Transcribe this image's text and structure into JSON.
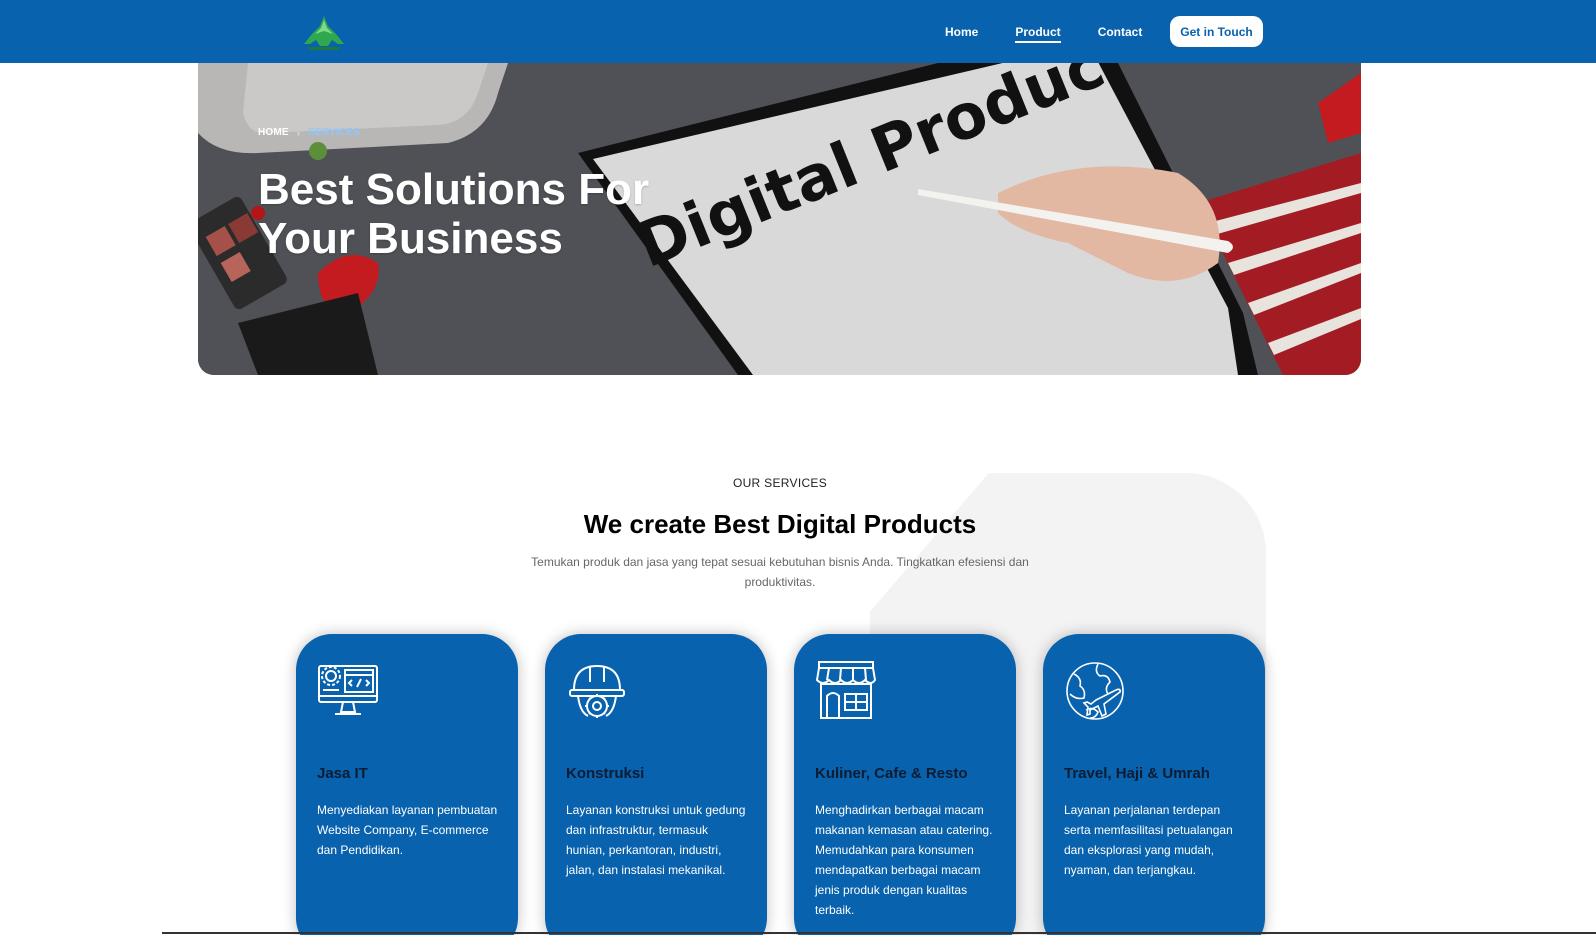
{
  "header": {
    "nav": [
      {
        "label": "Home",
        "active": false
      },
      {
        "label": "Product",
        "active": true
      },
      {
        "label": "Contact",
        "active": false
      }
    ],
    "cta_label": "Get in Touch",
    "brand_color": "#0862ae"
  },
  "hero": {
    "breadcrumb": {
      "home": "HOME",
      "current": "SERVICES"
    },
    "title_line1": "Best Solutions For",
    "title_line2": "Your Business",
    "image_text": "Digital Produc"
  },
  "services": {
    "kicker": "OUR SERVICES",
    "title": "We create Best Digital Products",
    "description": "Temukan produk dan jasa yang tepat sesuai kebutuhan bisnis Anda. Tingkatkan efesiensi dan produktivitas.",
    "cards": [
      {
        "icon": "computer-gear-icon",
        "title": "Jasa IT",
        "description": "Menyediakan layanan pembuatan Website Company, E-commerce dan Pendidikan."
      },
      {
        "icon": "hardhat-icon",
        "title": "Konstruksi",
        "description": "Layanan konstruksi untuk gedung dan infrastruktur, termasuk hunian, perkantoran, industri, jalan, dan instalasi mekanikal."
      },
      {
        "icon": "store-icon",
        "title": "Kuliner, Cafe & Resto",
        "description": "Menghadirkan berbagai macam makanan kemasan atau catering. Memudahkan para konsumen mendapatkan berbagai macam jenis produk dengan kualitas terbaik."
      },
      {
        "icon": "globe-plane-icon",
        "title": "Travel, Haji & Umrah",
        "description": "Layanan perjalanan terdepan serta memfasilitasi petualangan dan eksplorasi yang mudah, nyaman, dan terjangkau."
      }
    ]
  }
}
